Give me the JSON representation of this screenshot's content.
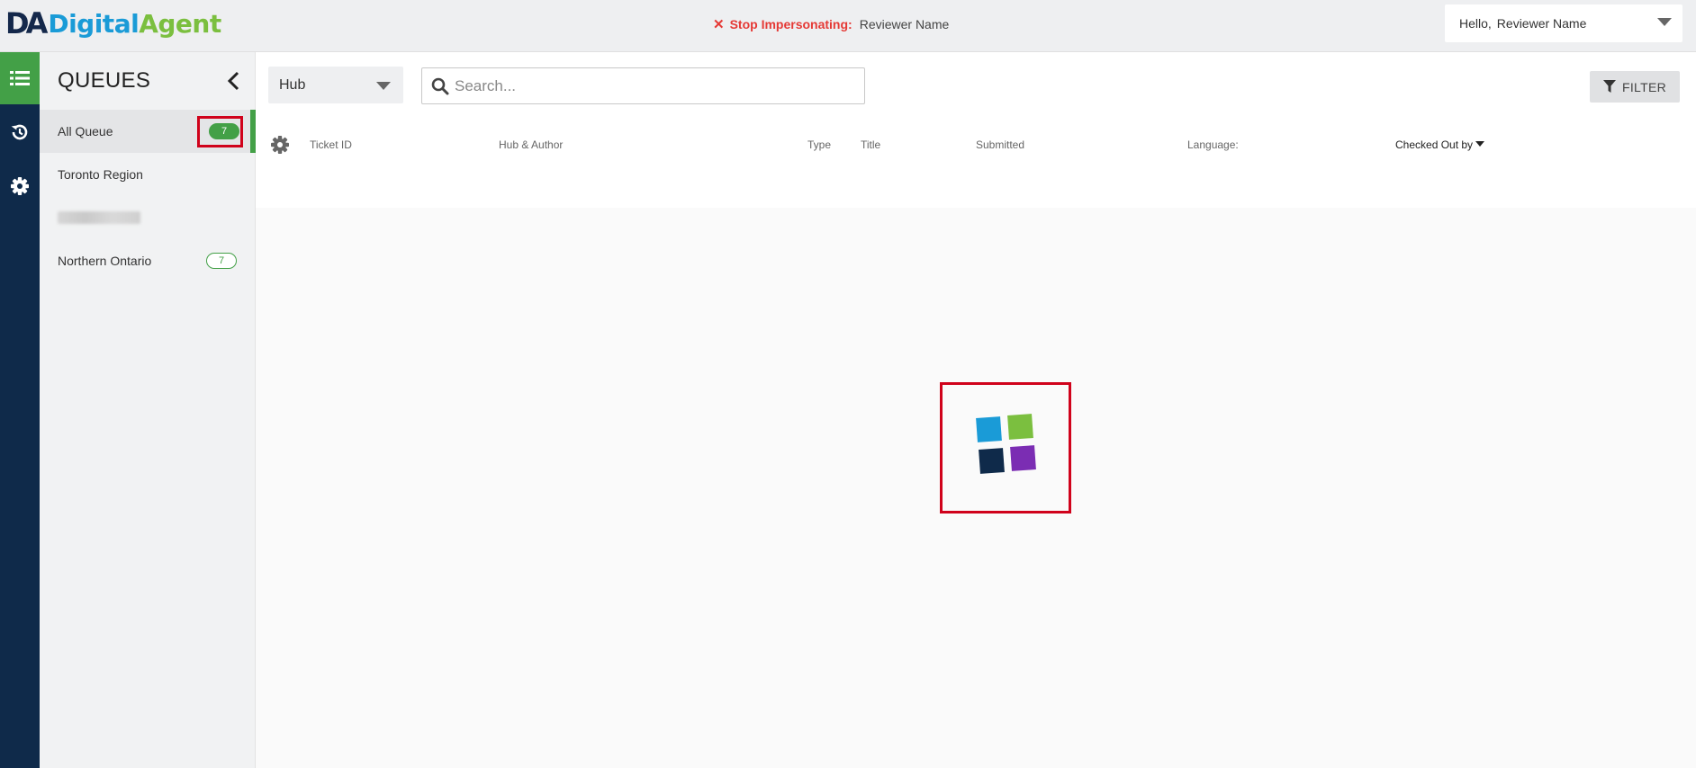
{
  "header": {
    "logo_mark": "DA",
    "logo_digital": "Digital",
    "logo_agent": "Agent",
    "impersonate_stop": "Stop Impersonating:",
    "impersonate_name": "Reviewer Name",
    "greeting": "Hello,",
    "user_name": "Reviewer Name"
  },
  "rail": {
    "items": [
      {
        "icon": "list-icon",
        "active": true
      },
      {
        "icon": "history-icon",
        "active": false
      },
      {
        "icon": "gear-icon",
        "active": false
      }
    ]
  },
  "queues": {
    "title": "QUEUES",
    "items": [
      {
        "label": "All Queue",
        "count": "7",
        "active": true
      },
      {
        "label": "Toronto Region",
        "count": null,
        "active": false
      },
      {
        "label": "",
        "count": null,
        "active": false,
        "redacted": true
      },
      {
        "label": "Northern Ontario",
        "count": "7",
        "active": false
      }
    ]
  },
  "toolbar": {
    "hub_select": "Hub",
    "search_placeholder": "Search...",
    "filter_label": "FILTER"
  },
  "table": {
    "columns": [
      "Ticket ID",
      "Hub & Author",
      "Type",
      "Title",
      "Submitted",
      "Language:",
      "Checked Out by"
    ]
  },
  "loader": {
    "colors": [
      "#1a9bd7",
      "#7bbf3f",
      "#0f2a4a",
      "#7b2db3"
    ]
  },
  "colors": {
    "accent_green": "#43a047",
    "rail_navy": "#0f2a4a",
    "highlight_red": "#d0021b",
    "impersonate_red": "#e53935"
  }
}
